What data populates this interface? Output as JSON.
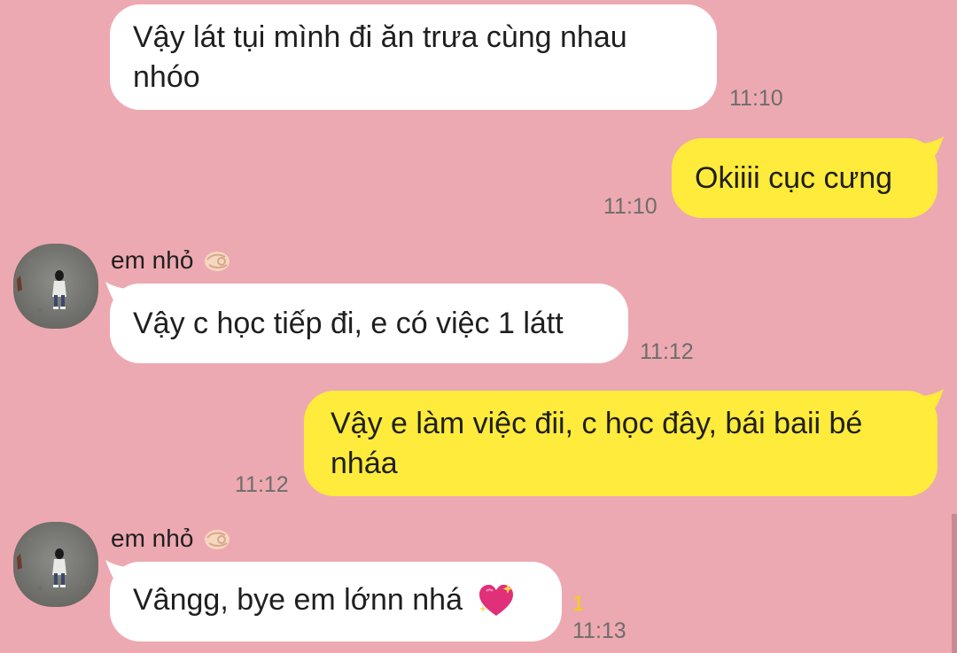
{
  "conversation": {
    "messages": [
      {
        "side": "left",
        "text": "Vậy lát tụi mình đi ăn trưa cùng nhau nhóo",
        "time": "11:10"
      },
      {
        "side": "right",
        "text": "Okiiii cục cưng",
        "time": "11:10"
      },
      {
        "side": "left",
        "sender": "em nhỏ",
        "text": "Vậy c học tiếp đi, e có việc 1 látt",
        "time": "11:12"
      },
      {
        "side": "right",
        "text": "Vậy e làm việc đii, c học đây, bái baii bé nháa",
        "time": "11:12"
      },
      {
        "side": "left",
        "sender": "em nhỏ",
        "text": "Vângg, bye em lớnn nhá",
        "time": "11:13",
        "unread_count": "1",
        "emoji_icon": "sparkling-heart-icon"
      }
    ]
  },
  "colors": {
    "background": "#eda9b1",
    "incoming_bubble": "#ffffff",
    "outgoing_bubble": "#ffeb3b",
    "timestamp": "#6d6d6d",
    "unread": "#f2d300"
  }
}
